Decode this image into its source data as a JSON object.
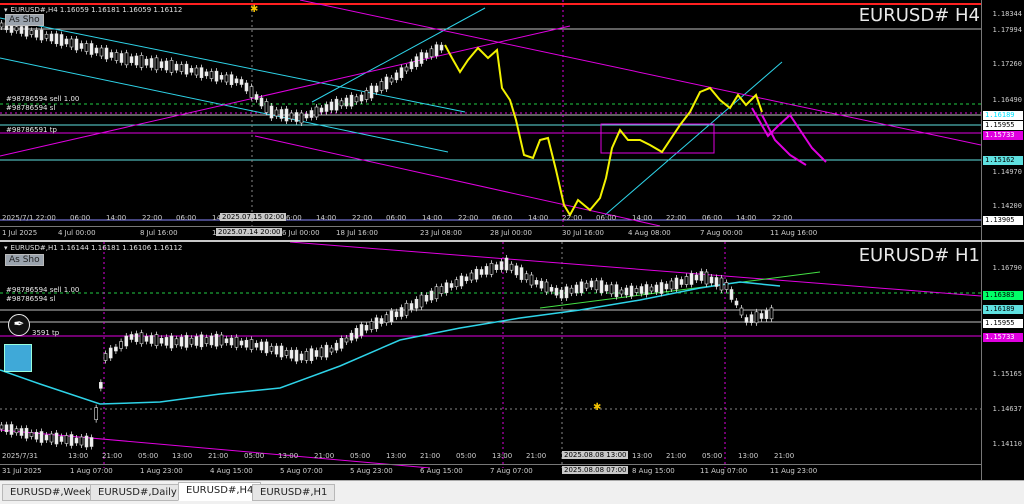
{
  "top": {
    "symbol_line": "EURUSD#,H4  1.16059 1.16181 1.16059 1.16112",
    "asshow": "As Sho",
    "title": "EURUSD#  H4",
    "orders": [
      "#98786594 sell 1.00",
      "#98786594 sl",
      "#98786591 tp"
    ],
    "price_labels": [
      "1.18344",
      "1.17994",
      "1.17260",
      "1.16490",
      "1.14970",
      "1.14200"
    ],
    "price_tags": [
      {
        "text": "1.16189",
        "color": "#00e5ff",
        "bg": "#ffffff"
      },
      {
        "text": "1.15955",
        "color": "#000000",
        "bg": "#ffffff"
      },
      {
        "text": "1.15733",
        "color": "#ffffff",
        "bg": "#e000e0"
      },
      {
        "text": "1.15162",
        "color": "#000000",
        "bg": "#5fe0e0"
      },
      {
        "text": "1.13905",
        "color": "#000000",
        "bg": "#ffffff"
      }
    ],
    "time_labels": [
      "2025/7/1 22:00",
      "06:00",
      "14:00",
      "22:00",
      "06:00",
      "14:00",
      "2025.07.15 02:00",
      "6:00",
      "14:00",
      "22:00",
      "06:00",
      "14:00",
      "22:00",
      "06:00",
      "14:00",
      "22:00",
      "06:00",
      "14:00",
      "22:00",
      "06:00",
      "14:00",
      "22:00"
    ],
    "time_labels_bottom": [
      "1 Jul 2025",
      "4 Jul 00:00",
      "8 Jul 16:00",
      "1",
      "2025.07.14 20:00",
      "6 Jul 00:00",
      "18 Jul 16:00",
      "23 Jul 08:00",
      "28 Jul 00:00",
      "30 Jul 16:00",
      "4 Aug 08:00",
      "7 Aug 00:00",
      "11 Aug 16:00"
    ]
  },
  "bottom": {
    "symbol_line": "EURUSD#,H1  1.16144 1.16181 1.16106 1.16112",
    "asshow": "As Sho",
    "title": "EURUSD#  H1",
    "orders": [
      "#98786594 sell 1.00",
      "#98786594 sl",
      "3591 tp"
    ],
    "price_labels": [
      "1.16790",
      "1.15165",
      "1.14637",
      "1.14110"
    ],
    "price_tags": [
      {
        "text": "1.16383",
        "color": "#000000",
        "bg": "#00ff66"
      },
      {
        "text": "1.16189",
        "color": "#000000",
        "bg": "#5fe0e0"
      },
      {
        "text": "1.15955",
        "color": "#000000",
        "bg": "#ffffff"
      },
      {
        "text": "1.15733",
        "color": "#ffffff",
        "bg": "#e000e0"
      }
    ],
    "time_labels": [
      "2025/7/31",
      "13:00",
      "21:00",
      "05:00",
      "13:00",
      "21:00",
      "05:00",
      "13:00",
      "21:00",
      "05:00",
      "13:00",
      "21:00",
      "05:00",
      "13:00",
      "21:00",
      "05:00",
      "13:00",
      "21:00",
      "05:00",
      "13:00",
      "21:00",
      "05:00"
    ],
    "time_labels_bottom": [
      "31 Jul 2025",
      "1 Aug 07:00",
      "1 Aug 23:00",
      "4 Aug 15:00",
      "5 Aug 07:00",
      "5 Aug 23:00",
      "6 Aug 15:00",
      "7 Aug 07:00",
      "2025.08.08 07:00",
      "8 Aug 15:00",
      "11 Aug 07:00",
      "11 Aug 23:00"
    ],
    "hl_top": "2025.08.08 13:00"
  },
  "tabs": [
    "EURUSD#,Weekly",
    "EURUSD#,Daily",
    "EURUSD#,H4",
    "EURUSD#,H1"
  ],
  "active_tab": "EURUSD#,H4"
}
